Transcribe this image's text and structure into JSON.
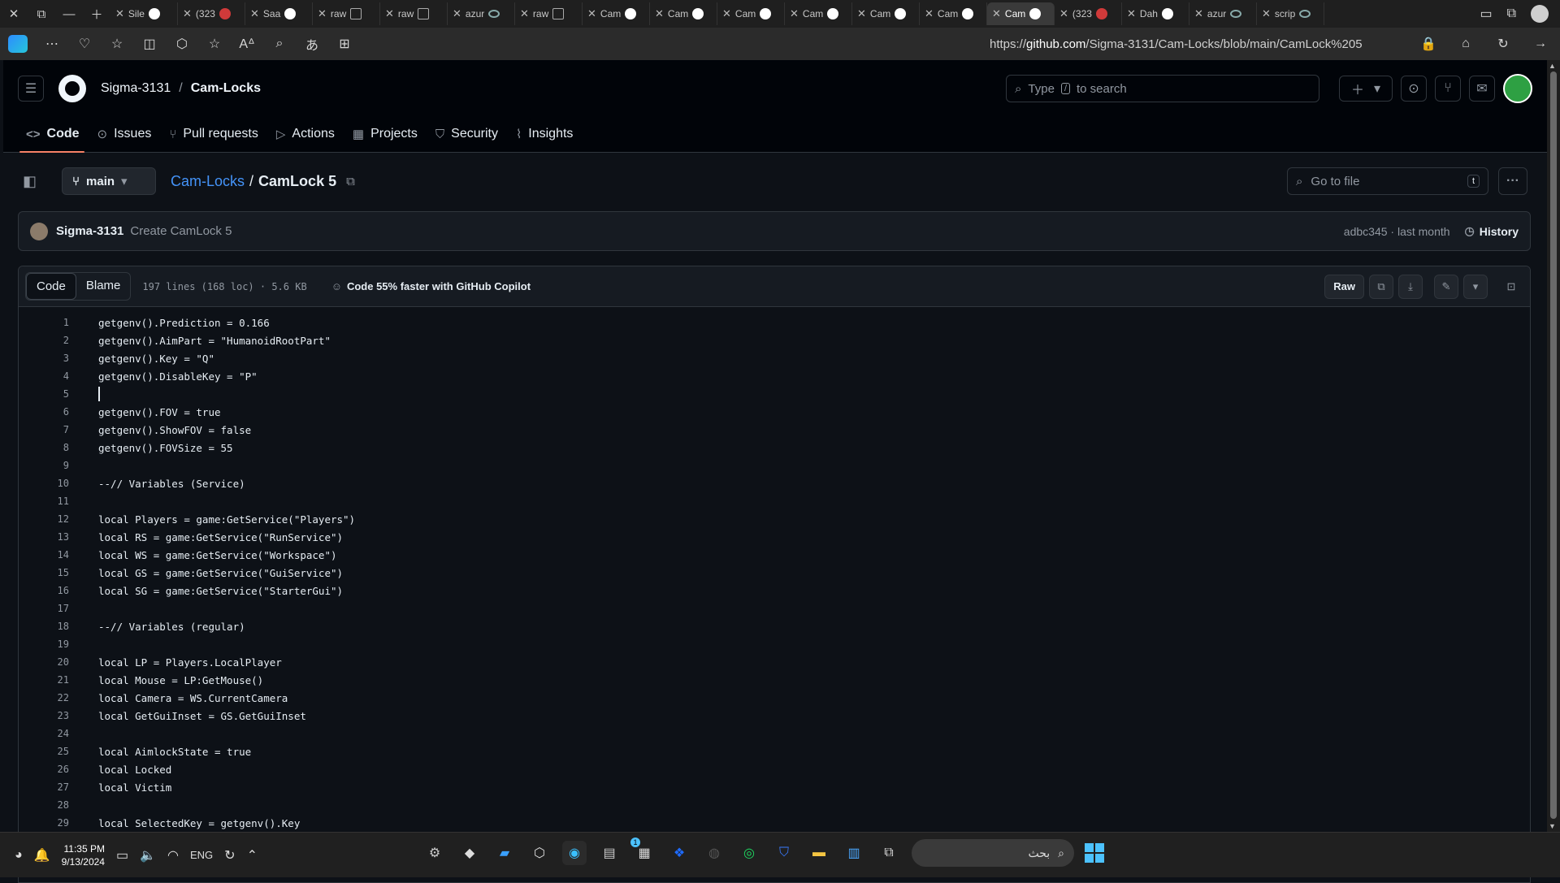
{
  "browser": {
    "tabs": [
      {
        "label": "Sile",
        "favicon": "github-icon"
      },
      {
        "label": "(323",
        "favicon": "red-icon"
      },
      {
        "label": "Saa",
        "favicon": "github-icon"
      },
      {
        "label": "raw",
        "favicon": "doc-icon"
      },
      {
        "label": "raw",
        "favicon": "doc-icon"
      },
      {
        "label": "azur",
        "favicon": "search-icon"
      },
      {
        "label": "raw",
        "favicon": "doc-icon"
      },
      {
        "label": "Cam",
        "favicon": "github-icon"
      },
      {
        "label": "Cam",
        "favicon": "github-icon"
      },
      {
        "label": "Cam",
        "favicon": "github-icon"
      },
      {
        "label": "Cam",
        "favicon": "github-icon"
      },
      {
        "label": "Cam",
        "favicon": "github-icon"
      },
      {
        "label": "Cam",
        "favicon": "github-icon"
      },
      {
        "label": "Cam",
        "favicon": "github-icon",
        "active": true
      },
      {
        "label": "(323",
        "favicon": "red-icon"
      },
      {
        "label": "Dah",
        "favicon": "github-icon"
      },
      {
        "label": "azur",
        "favicon": "search-icon"
      },
      {
        "label": "scrip",
        "favicon": "search-icon"
      }
    ],
    "url_prefix": "https://",
    "url_host": "github.com",
    "url_path": "/Sigma-3131/Cam-Locks/blob/main/CamLock%205"
  },
  "github": {
    "owner": "Sigma-3131",
    "repo": "Cam-Locks",
    "search_placeholder_pre": "Type",
    "search_key": "/",
    "search_placeholder_post": "to search",
    "nav": [
      {
        "label": "Code",
        "icon": "code-icon",
        "glyph": "<>",
        "active": true
      },
      {
        "label": "Issues",
        "icon": "issue-icon",
        "glyph": "⊙"
      },
      {
        "label": "Pull requests",
        "icon": "pull-request-icon",
        "glyph": "⑂"
      },
      {
        "label": "Actions",
        "icon": "play-icon",
        "glyph": "▷"
      },
      {
        "label": "Projects",
        "icon": "table-icon",
        "glyph": "▦"
      },
      {
        "label": "Security",
        "icon": "shield-icon",
        "glyph": "⛉"
      },
      {
        "label": "Insights",
        "icon": "graph-icon",
        "glyph": "⌇"
      }
    ]
  },
  "file": {
    "branch": "main",
    "repo_link": "Cam-Locks",
    "separator": "/",
    "filename": "CamLock 5",
    "goto_placeholder": "Go to file",
    "goto_key": "t",
    "commit": {
      "author": "Sigma-3131",
      "message": "Create CamLock 5",
      "meta": "adbc345 · last month",
      "history": "History"
    },
    "view_code": "Code",
    "view_blame": "Blame",
    "stats": "197 lines (168 loc) · 5.6 KB",
    "copilot": "Code 55% faster with GitHub Copilot",
    "raw": "Raw"
  },
  "code_lines": [
    "getgenv().Prediction = 0.166",
    "getgenv().AimPart = \"HumanoidRootPart\"",
    "getgenv().Key = \"Q\"",
    "getgenv().DisableKey = \"P\"",
    "",
    "getgenv().FOV = true",
    "getgenv().ShowFOV = false",
    "getgenv().FOVSize = 55",
    "",
    "--// Variables (Service)",
    "",
    "local Players = game:GetService(\"Players\")",
    "local RS = game:GetService(\"RunService\")",
    "local WS = game:GetService(\"Workspace\")",
    "local GS = game:GetService(\"GuiService\")",
    "local SG = game:GetService(\"StarterGui\")",
    "",
    "--// Variables (regular)",
    "",
    "local LP = Players.LocalPlayer",
    "local Mouse = LP:GetMouse()",
    "local Camera = WS.CurrentCamera",
    "local GetGuiInset = GS.GetGuiInset",
    "",
    "local AimlockState = true",
    "local Locked",
    "local Victim",
    "",
    "local SelectedKey = getgenv().Key"
  ],
  "taskbar": {
    "time": "11:35 PM",
    "date": "9/13/2024",
    "lang": "ENG",
    "search_text": "بحث",
    "badge": "1"
  }
}
